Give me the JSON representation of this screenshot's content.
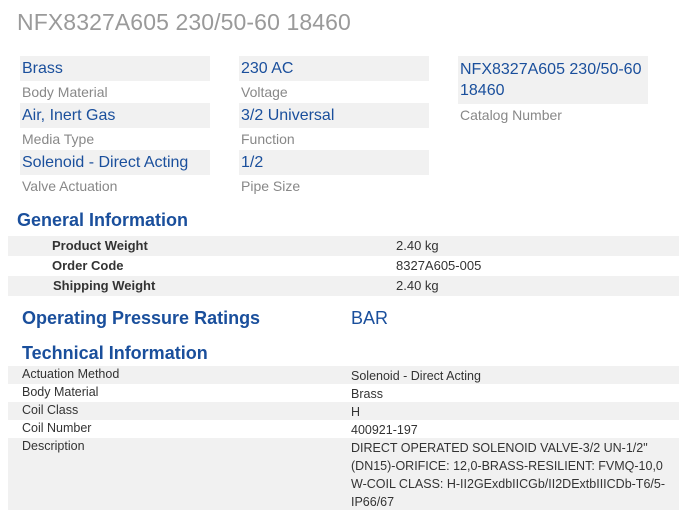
{
  "page_title": "NFX8327A605 230/50-60 18460",
  "attributes": [
    {
      "value": "Brass",
      "label": "Body Material"
    },
    {
      "value": "230 AC",
      "label": "Voltage"
    },
    {
      "value": "NFX8327A605 230/50-60 18460",
      "label": "Catalog Number"
    },
    {
      "value": "Air, Inert Gas",
      "label": "Media Type"
    },
    {
      "value": "3/2 Universal",
      "label": "Function"
    },
    {
      "value": "Solenoid - Direct Acting",
      "label": "Valve Actuation"
    },
    {
      "value": "1/2",
      "label": "Pipe Size"
    }
  ],
  "general": {
    "title": "General Information",
    "rows": [
      {
        "key": "Product Weight",
        "value": "2.40 kg"
      },
      {
        "key": "Order Code",
        "value": "8327A605-005"
      },
      {
        "key": "Shipping Weight",
        "value": "2.40 kg"
      }
    ]
  },
  "pressure": {
    "title": "Operating Pressure Ratings",
    "unit": "BAR"
  },
  "technical": {
    "title": "Technical Information",
    "rows": [
      {
        "key": "Actuation Method",
        "value": "Solenoid - Direct Acting"
      },
      {
        "key": "Body Material",
        "value": "Brass"
      },
      {
        "key": "Coil Class",
        "value": "H"
      },
      {
        "key": "Coil Number",
        "value": "400921-197"
      },
      {
        "key": "Description",
        "value": "DIRECT OPERATED SOLENOID VALVE-3/2 UN-1/2\" (DN15)-ORIFICE: 12,0-BRASS-RESILIENT: FVMQ-10,0 W-COIL CLASS: H-II2GExdbIICGb/II2DExtbIIICDb-T6/5-IP66/67"
      }
    ]
  }
}
